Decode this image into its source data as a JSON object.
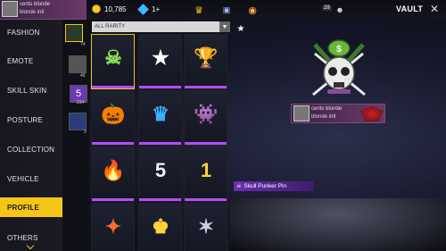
{
  "header": {
    "profile": {
      "name": "cents blonde",
      "tag": "blonde intl"
    },
    "coins": "10,785",
    "diamonds": "1+",
    "level": "29",
    "vault_label": "VAULT",
    "close": "✕"
  },
  "sidebar": {
    "items": [
      {
        "label": "FASHION"
      },
      {
        "label": "EMOTE"
      },
      {
        "label": "SKILL SKIN"
      },
      {
        "label": "POSTURE"
      },
      {
        "label": "COLLECTION"
      },
      {
        "label": "VEHICLE"
      },
      {
        "label": "PROFILE",
        "active": true
      },
      {
        "label": "OTHERS"
      }
    ]
  },
  "subcategories": [
    {
      "count": "74",
      "icon": "skull-pin-icon"
    },
    {
      "count": "46",
      "icon": "avatar-icon"
    },
    {
      "count": "234",
      "icon": "badge-five-icon"
    },
    {
      "count": "3",
      "icon": "banner-icon"
    }
  ],
  "filter": {
    "label": "ALL RARITY",
    "dropdown": "▼"
  },
  "favorite_icon": "★",
  "grid_items": [
    {
      "icon": "skull-pin-icon",
      "glyph": "☠",
      "color": "#8ee05a",
      "selected": true
    },
    {
      "icon": "star-shield-icon",
      "glyph": "★",
      "color": "#ffffff"
    },
    {
      "icon": "trophy-icon",
      "glyph": "🏆",
      "color": "#dddddd"
    },
    {
      "icon": "pumpkin-icon",
      "glyph": "🎃",
      "color": "#ff8a2a"
    },
    {
      "icon": "blue-crown-icon",
      "glyph": "♛",
      "color": "#3ab0ff"
    },
    {
      "icon": "purple-monster-icon",
      "glyph": "👾",
      "color": "#c070ff"
    },
    {
      "icon": "fire-icon",
      "glyph": "🔥",
      "color": "#ff4a3a"
    },
    {
      "icon": "number-five-icon",
      "glyph": "5",
      "color": "#f0f0ff"
    },
    {
      "icon": "number-one-icon",
      "glyph": "1",
      "color": "#ffd23a"
    },
    {
      "icon": "fire-wings-icon",
      "glyph": "✦",
      "color": "#ff6a2a"
    },
    {
      "icon": "gold-crown-icon",
      "glyph": "♚",
      "color": "#ffd23a"
    },
    {
      "icon": "star-crest-icon",
      "glyph": "✶",
      "color": "#cfcfe8"
    }
  ],
  "preview": {
    "item_name": "Skull Punker Pin",
    "tag_name": "cents blonde",
    "tag_line": "blonde intl",
    "dots": "• • •"
  }
}
